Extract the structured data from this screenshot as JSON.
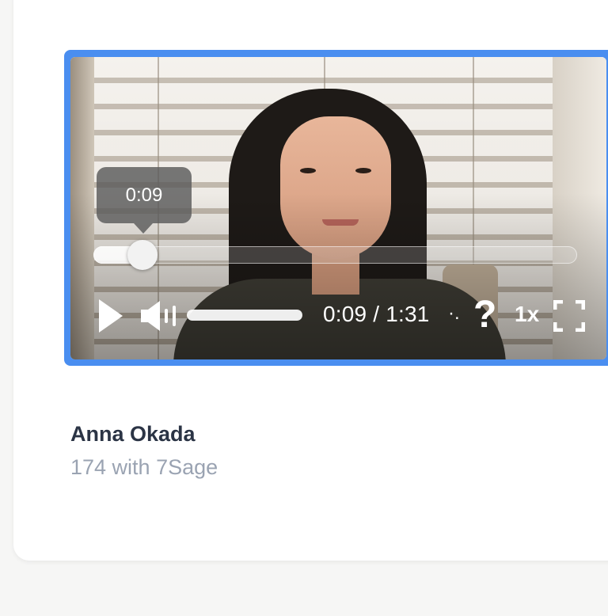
{
  "player": {
    "tooltip_time": "0:09",
    "current_time": "0:09",
    "separator": "/",
    "duration": "1:31",
    "speed": "1x",
    "help_symbol": "?",
    "dots_symbol": "·.",
    "progress_fraction": 0.1,
    "volume_fraction": 1.0,
    "accent_color": "#4a8ef0",
    "icons": {
      "play": "play-icon",
      "volume": "volume-icon",
      "help": "help-icon",
      "fullscreen": "fullscreen-icon"
    }
  },
  "caption": {
    "name": "Anna Okada",
    "subtitle": "174 with 7Sage"
  }
}
